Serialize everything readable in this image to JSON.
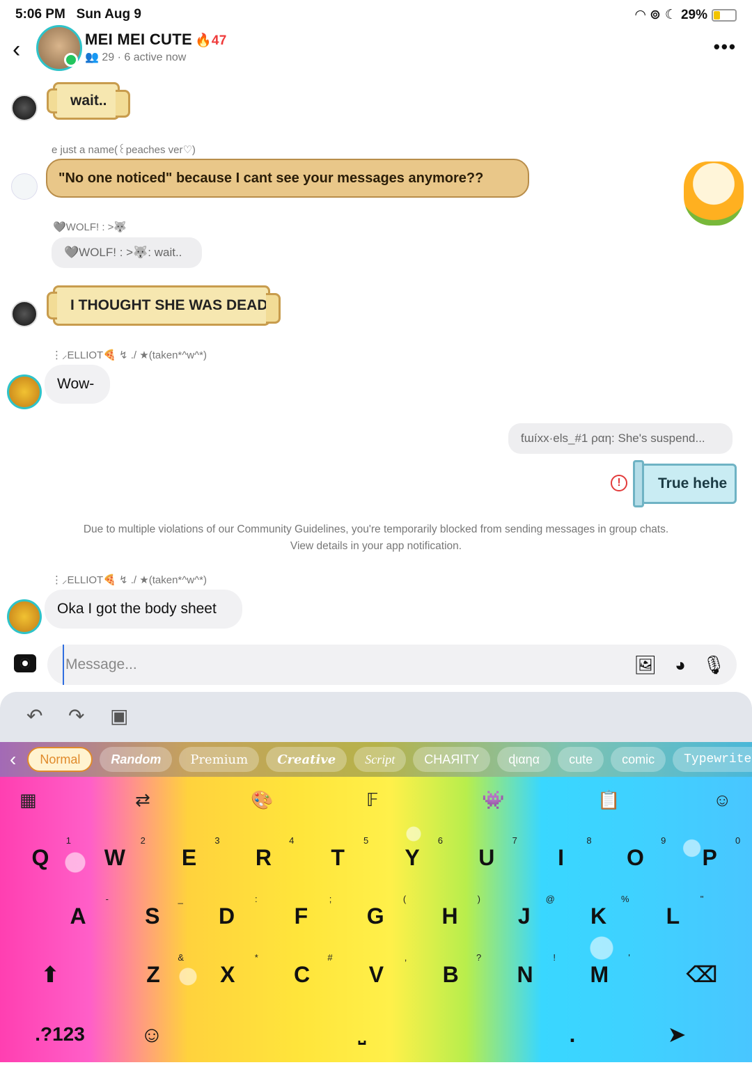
{
  "status": {
    "time": "5:06 PM",
    "date": "Sun Aug 9",
    "battery": "29%",
    "battery_level": 0.29
  },
  "header": {
    "title": "MEI MEI CUTE",
    "streak": "47",
    "members": "29",
    "active": "6 active now"
  },
  "messages": {
    "m1": "wait..",
    "m2_sender": "e just a name(꒰peaches ver♡)",
    "m2": "\"No one noticed\" because I cant see your messages anymore??",
    "m3_sender": "🩶WOLF! : >🐺",
    "m3_reply": "🩶WOLF! : >🐺: wait..",
    "m3": "I THOUGHT SHE WAS DEAD",
    "m4_sender": "⋮⸝ELLIOT🍕 ↯ ./ ★(taken*^w^*)",
    "m4": "Wow-",
    "m5_reply": "ƭɯíxx·els_#1 ραη: She's suspend...",
    "m5": "True hehe",
    "m6_sender": "⋮⸝ELLIOT🍕 ↯ ./ ★(taken*^w^*)",
    "m6": "Oka I got the body sheet"
  },
  "notice": {
    "line1": "Due to multiple violations of our Community Guidelines, you're temporarily blocked from sending messages in group chats.",
    "line2": "View details in your app notification."
  },
  "composer": {
    "placeholder": "Message..."
  },
  "fonts": [
    "Normal",
    "Random",
    "Premium",
    "Creative",
    "Script",
    "ϹHΑЯITY",
    "ɖιαηα",
    "cute",
    "comic",
    "Typewriter"
  ],
  "keys": {
    "row1": [
      "Q",
      "W",
      "E",
      "R",
      "T",
      "Y",
      "U",
      "I",
      "O",
      "P"
    ],
    "row1_hints": [
      "1",
      "2",
      "3",
      "4",
      "5",
      "6",
      "7",
      "8",
      "9",
      "0"
    ],
    "row2": [
      "A",
      "S",
      "D",
      "F",
      "G",
      "H",
      "J",
      "K",
      "L"
    ],
    "row2_hints": [
      "-",
      "_",
      ":",
      ";",
      "(",
      ")",
      "@",
      "%",
      "\""
    ],
    "row3": [
      "Z",
      "X",
      "C",
      "V",
      "B",
      "N",
      "M"
    ],
    "row3_hints": [
      "&",
      "*",
      "#",
      ",",
      "?",
      "!",
      "'"
    ],
    "num": ".?123"
  }
}
